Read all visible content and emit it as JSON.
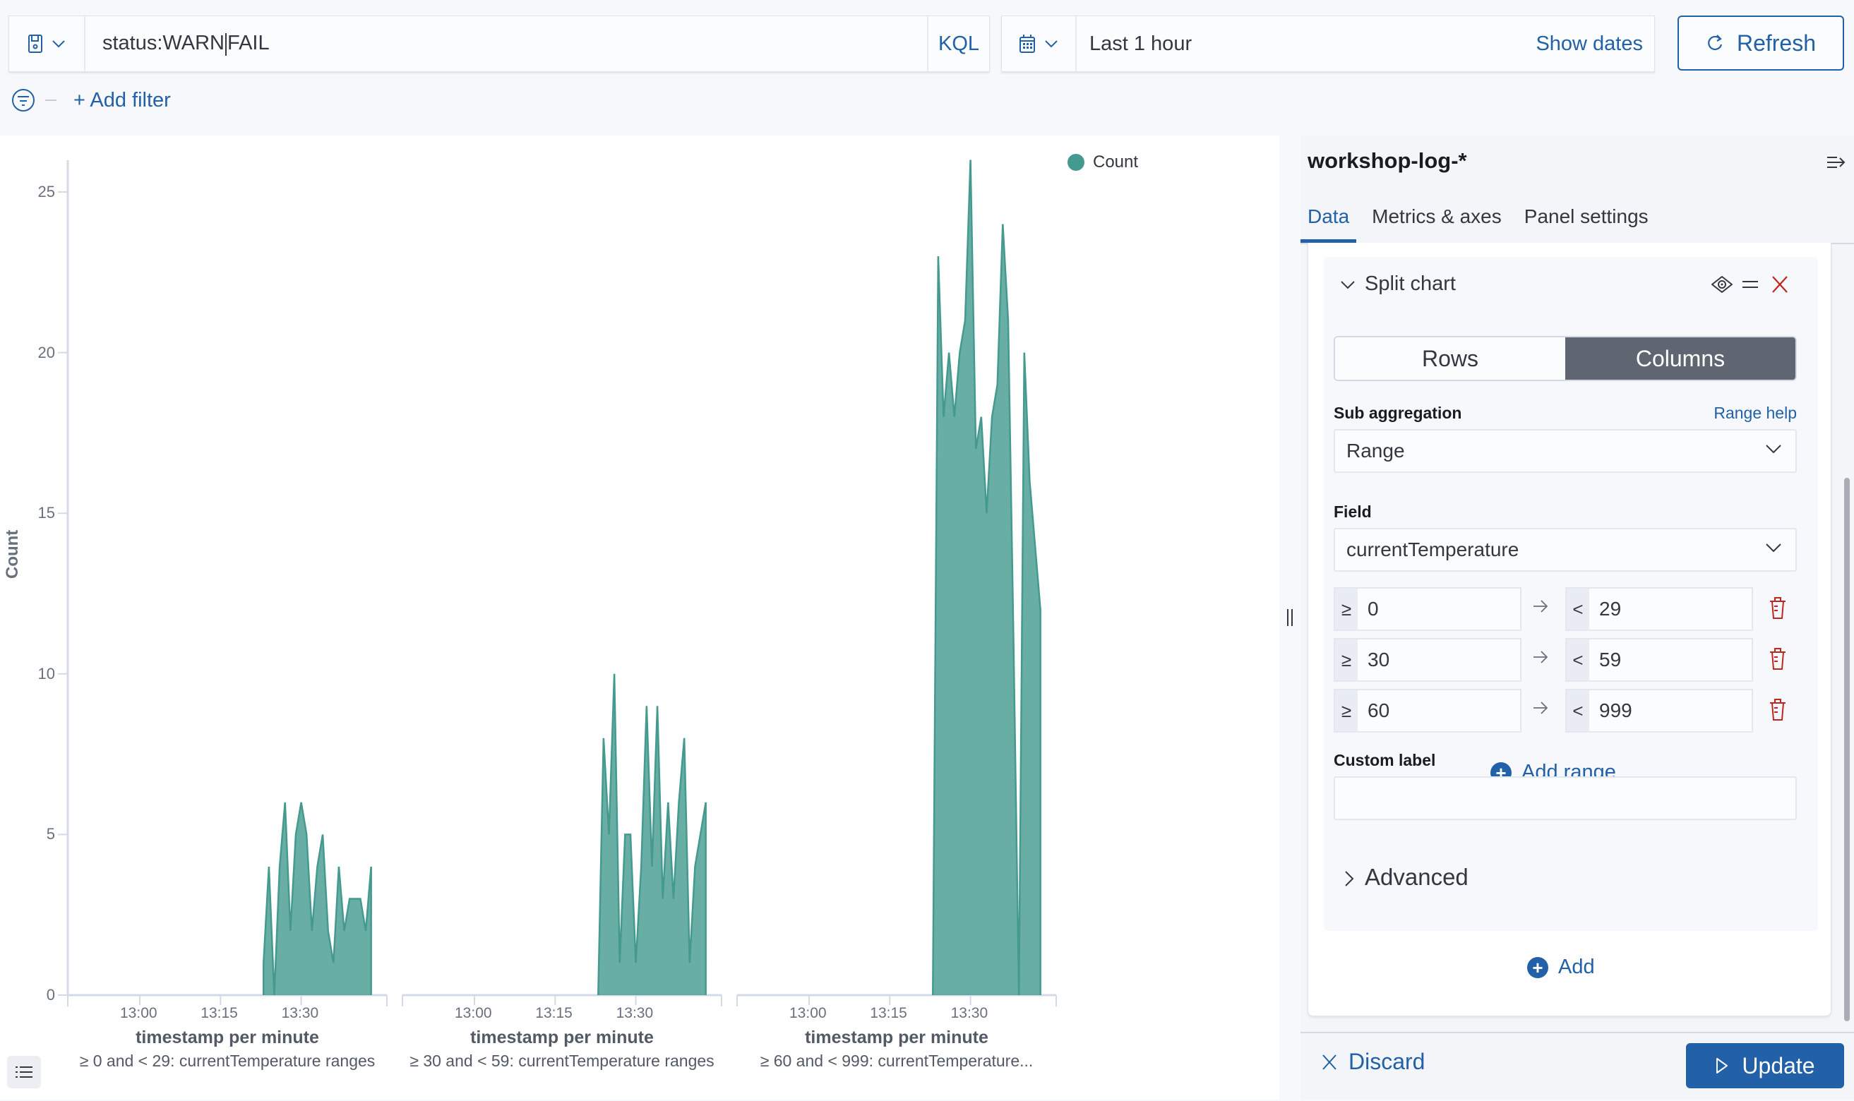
{
  "query_bar": {
    "query_before_cursor": "status:WARN",
    "query_after_cursor": "FAIL",
    "language_label": "KQL"
  },
  "time_picker": {
    "range_label": "Last 1 hour",
    "show_dates_label": "Show dates"
  },
  "refresh_label": "Refresh",
  "filter_bar": {
    "add_filter_label": "+ Add filter"
  },
  "icons": {
    "saved_query": "save-icon",
    "calendar": "calendar-icon",
    "refresh": "refresh-icon",
    "filter": "filter-icon",
    "legend_toggle": "list-icon",
    "collapse": "menu-collapse-icon",
    "visibility": "eye-icon",
    "drag": "grab-icon",
    "remove": "cross-icon",
    "delete": "trash-icon",
    "add": "plus-in-circle-icon"
  },
  "colors": {
    "series": "#449a8f",
    "accent": "#2260a8",
    "danger": "#bd271e"
  },
  "chart_data": {
    "type": "area",
    "legend": [
      {
        "name": "Count",
        "color": "#449a8f"
      }
    ],
    "legend_position": "top-right",
    "ylabel": "Count",
    "ylim": [
      0,
      26
    ],
    "yticks": [
      "0",
      "5",
      "10",
      "15",
      "20",
      "25"
    ],
    "xlabel": "timestamp per minute",
    "xticks": [
      "13:00",
      "13:15",
      "13:30"
    ],
    "x_interval": "1 minute",
    "panels": [
      {
        "label": "≥ 0 and < 29: currentTemperature ranges",
        "start_minute_after_1300": 23,
        "values": [
          1,
          4,
          0,
          4,
          6,
          2,
          5,
          6,
          5,
          2,
          4,
          5,
          2,
          1,
          4,
          2,
          3,
          3,
          3,
          2,
          4
        ]
      },
      {
        "label": "≥ 30 and < 59: currentTemperature ranges",
        "start_minute_after_1300": 23,
        "values": [
          0,
          8,
          5,
          10,
          1,
          5,
          5,
          1,
          4,
          9,
          4,
          9,
          3,
          6,
          3,
          6,
          8,
          1,
          4,
          5,
          6
        ]
      },
      {
        "label": "≥ 60 and < 999: currentTemperature...",
        "start_minute_after_1300": 23,
        "values": [
          0,
          23,
          18,
          20,
          18,
          20,
          21,
          26,
          17,
          18,
          15,
          18,
          19,
          24,
          21,
          11,
          0,
          20,
          16,
          14,
          12
        ]
      }
    ]
  },
  "sidebar": {
    "index_pattern": "workshop-log-*",
    "tabs": [
      {
        "label": "Data",
        "active": true
      },
      {
        "label": "Metrics & axes",
        "active": false
      },
      {
        "label": "Panel settings",
        "active": false
      }
    ],
    "split_chart": {
      "title": "Split chart",
      "mode_options": [
        "Rows",
        "Columns"
      ],
      "mode_selected": "Columns",
      "sub_aggregation_label": "Sub aggregation",
      "range_help_label": "Range help",
      "sub_aggregation_value": "Range",
      "field_label": "Field",
      "field_value": "currentTemperature",
      "ranges": [
        {
          "from_op": "≥",
          "from": "0",
          "to_op": "<",
          "to": "29"
        },
        {
          "from_op": "≥",
          "from": "30",
          "to_op": "<",
          "to": "59"
        },
        {
          "from_op": "≥",
          "from": "60",
          "to_op": "<",
          "to": "999"
        }
      ],
      "add_range_label": "Add range",
      "custom_label_label": "Custom label",
      "custom_label_value": "",
      "advanced_label": "Advanced"
    },
    "add_label": "Add",
    "discard_label": "Discard",
    "update_label": "Update"
  }
}
